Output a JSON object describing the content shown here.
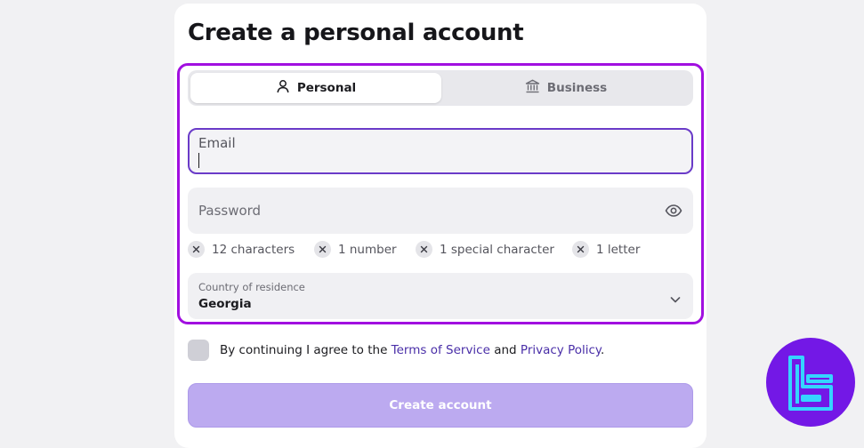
{
  "page": {
    "title": "Create a personal account"
  },
  "tabs": [
    {
      "label": "Personal",
      "icon": "person-icon",
      "active": true
    },
    {
      "label": "Business",
      "icon": "bank-icon",
      "active": false
    }
  ],
  "email": {
    "label": "Email",
    "value": ""
  },
  "password": {
    "placeholder": "Password",
    "icon": "eye-icon"
  },
  "requirements": [
    {
      "label": "12 characters",
      "met": false
    },
    {
      "label": "1 number",
      "met": false
    },
    {
      "label": "1 special character",
      "met": false
    },
    {
      "label": "1 letter",
      "met": false
    }
  ],
  "country": {
    "label": "Country of residence",
    "value": "Georgia"
  },
  "agreement": {
    "prefix": "By continuing I agree to the",
    "terms_link": "Terms of Service",
    "middle": "and",
    "privacy_link": "Privacy Policy",
    "suffix": ".",
    "checked": false
  },
  "submit": {
    "label": "Create account"
  },
  "colors": {
    "highlight_border": "#a10fe0",
    "submit_bg": "#bcaaf0",
    "link": "#4a2fa8",
    "logo_bg": "#7318e6",
    "logo_stroke": "#35d4ff"
  }
}
